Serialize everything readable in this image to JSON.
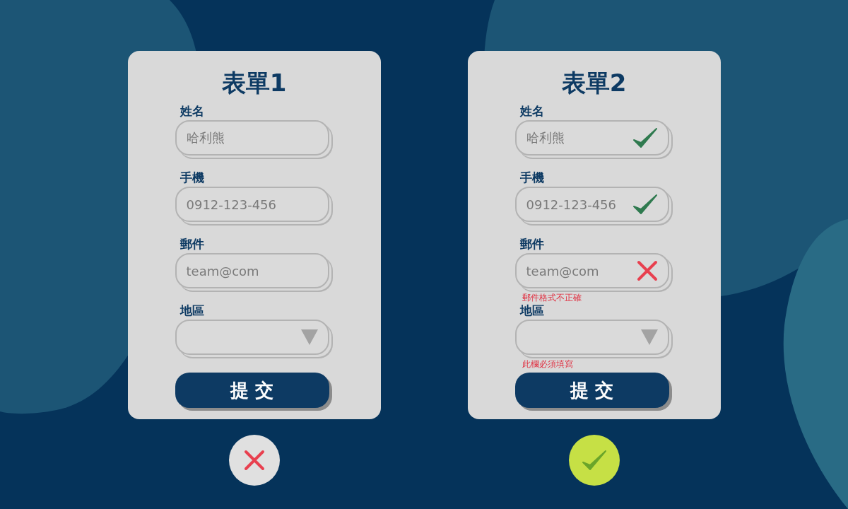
{
  "forms": [
    {
      "title": "表單1",
      "passed": false,
      "submit": "提 交",
      "fields": [
        {
          "label": "姓名",
          "kind": "text",
          "value": "哈利熊",
          "valid": false,
          "invalid": false
        },
        {
          "label": "手機",
          "kind": "text",
          "value": "0912-123-456",
          "valid": false,
          "invalid": false
        },
        {
          "label": "郵件",
          "kind": "text",
          "value": "team@com",
          "valid": false,
          "invalid": false
        },
        {
          "label": "地區",
          "kind": "select",
          "valid": false,
          "invalid": false
        }
      ]
    },
    {
      "title": "表單2",
      "passed": true,
      "submit": "提 交",
      "fields": [
        {
          "label": "姓名",
          "kind": "text",
          "value": "哈利熊",
          "valid": true,
          "invalid": false
        },
        {
          "label": "手機",
          "kind": "text",
          "value": "0912-123-456",
          "valid": true,
          "invalid": false
        },
        {
          "label": "郵件",
          "kind": "text",
          "value": "team@com",
          "valid": false,
          "invalid": true,
          "error": "郵件格式不正確"
        },
        {
          "label": "地區",
          "kind": "select",
          "valid": false,
          "invalid": false,
          "error": "此欄必須填寫"
        }
      ]
    }
  ]
}
